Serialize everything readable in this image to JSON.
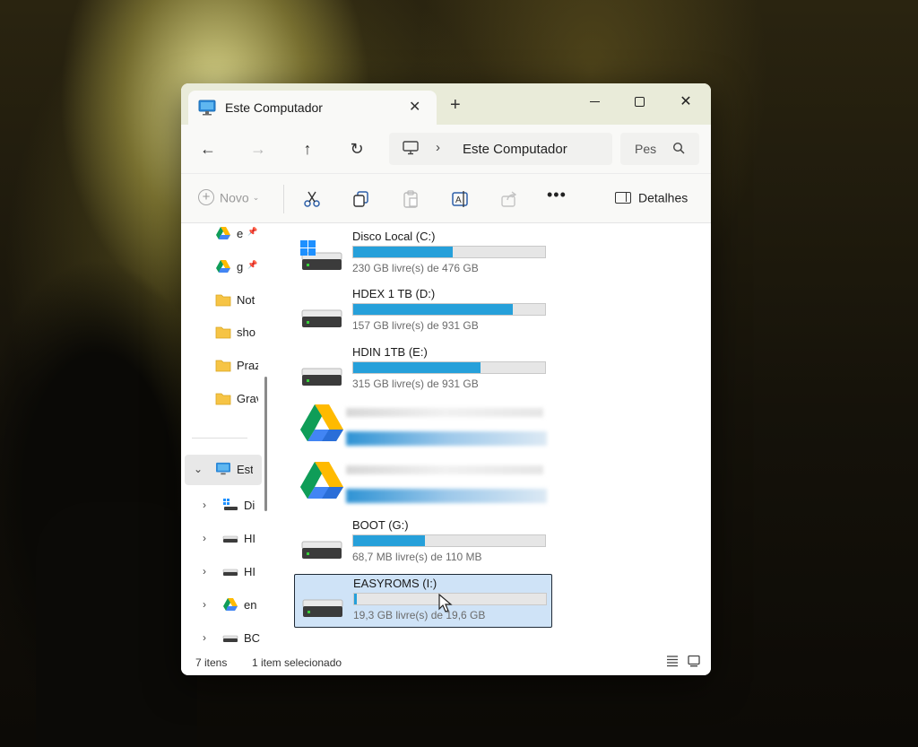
{
  "window": {
    "tab_title": "Este Computador",
    "tab_close": "✕",
    "new_tab": "+",
    "close_glyph": "✕"
  },
  "nav": {
    "back": "←",
    "forward": "→",
    "up": "↑",
    "refresh": "↻",
    "chevron": "›",
    "address": "Este Computador",
    "search_placeholder": "Pesquisar"
  },
  "toolbar": {
    "new_label": "Novo",
    "new_caret": "⌄",
    "more": "•••",
    "details_label": "Detalhes"
  },
  "sidebar": {
    "quick_access": [
      {
        "label": "e",
        "icon": "google-drive-icon",
        "pinned": true
      },
      {
        "label": "g",
        "icon": "google-drive-icon",
        "pinned": true
      },
      {
        "label": "Not",
        "icon": "folder-icon"
      },
      {
        "label": "sho",
        "icon": "folder-icon"
      },
      {
        "label": "Praz",
        "icon": "folder-icon"
      },
      {
        "label": "Grav",
        "icon": "folder-icon"
      }
    ],
    "pin_glyph": "📌",
    "this_pc": {
      "label": "Este",
      "expanded": true,
      "chevron": "⌄"
    },
    "tree": [
      {
        "label": "Di",
        "icon": "windows-drive-icon",
        "chevron": "›"
      },
      {
        "label": "HI",
        "icon": "drive-icon",
        "chevron": "›"
      },
      {
        "label": "HI",
        "icon": "drive-icon",
        "chevron": "›"
      },
      {
        "label": "en",
        "icon": "google-drive-icon",
        "chevron": "›"
      },
      {
        "label": "BC",
        "icon": "drive-icon",
        "chevron": "›"
      }
    ]
  },
  "drives": [
    {
      "name": "Disco Local (C:)",
      "free_text": "230 GB livre(s) de 476 GB",
      "used_fraction": 0.517,
      "icon": "windows-drive-icon"
    },
    {
      "name": "HDEX 1 TB (D:)",
      "free_text": "157 GB livre(s) de 931 GB",
      "used_fraction": 0.831,
      "icon": "drive-icon"
    },
    {
      "name": "HDIN 1TB (E:)",
      "free_text": "315 GB livre(s) de 931 GB",
      "used_fraction": 0.662,
      "icon": "drive-icon"
    },
    {
      "name": "",
      "free_text": "",
      "used_fraction": null,
      "icon": "google-drive-icon",
      "blurred": true
    },
    {
      "name": "",
      "free_text": "",
      "used_fraction": null,
      "icon": "google-drive-icon",
      "blurred": true
    },
    {
      "name": "BOOT (G:)",
      "free_text": "68,7 MB livre(s) de 110 MB",
      "used_fraction": 0.375,
      "icon": "drive-icon"
    },
    {
      "name": "EASYROMS (I:)",
      "free_text": "19,3 GB livre(s) de 19,6 GB",
      "used_fraction": 0.015,
      "icon": "drive-icon",
      "selected": true
    }
  ],
  "status": {
    "item_count": "7 itens",
    "selection": "1 item selecionado"
  },
  "colors": {
    "accent": "#26a0da",
    "selection_bg": "#cfe3f7",
    "titlebar": "#e9ebd9"
  }
}
